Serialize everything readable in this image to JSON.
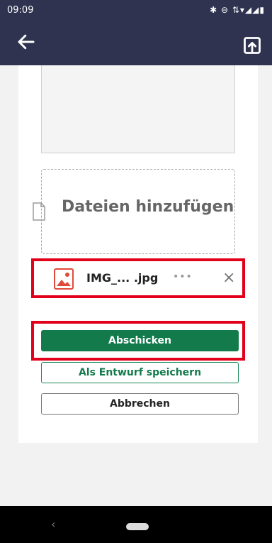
{
  "status_bar": {
    "time": "09:09",
    "icons": "✱ ⊖ ⇅▾◢◢▮"
  },
  "app_bar": {
    "back_icon": "arrow-left-icon",
    "share_icon": "share-box-icon"
  },
  "upload": {
    "dropzone_label": "Dateien hinzufügen"
  },
  "attachment": {
    "file_name": "IMG_... .jpg",
    "more": "•••",
    "remove": "×"
  },
  "actions": {
    "submit_label": "Abschicken",
    "draft_label": "Als Entwurf speichern",
    "cancel_label": "Abbrechen"
  },
  "colors": {
    "app_bar": "#2f3350",
    "primary": "#137a4c",
    "highlight": "#e3001b",
    "image_icon": "#e04a3a"
  }
}
